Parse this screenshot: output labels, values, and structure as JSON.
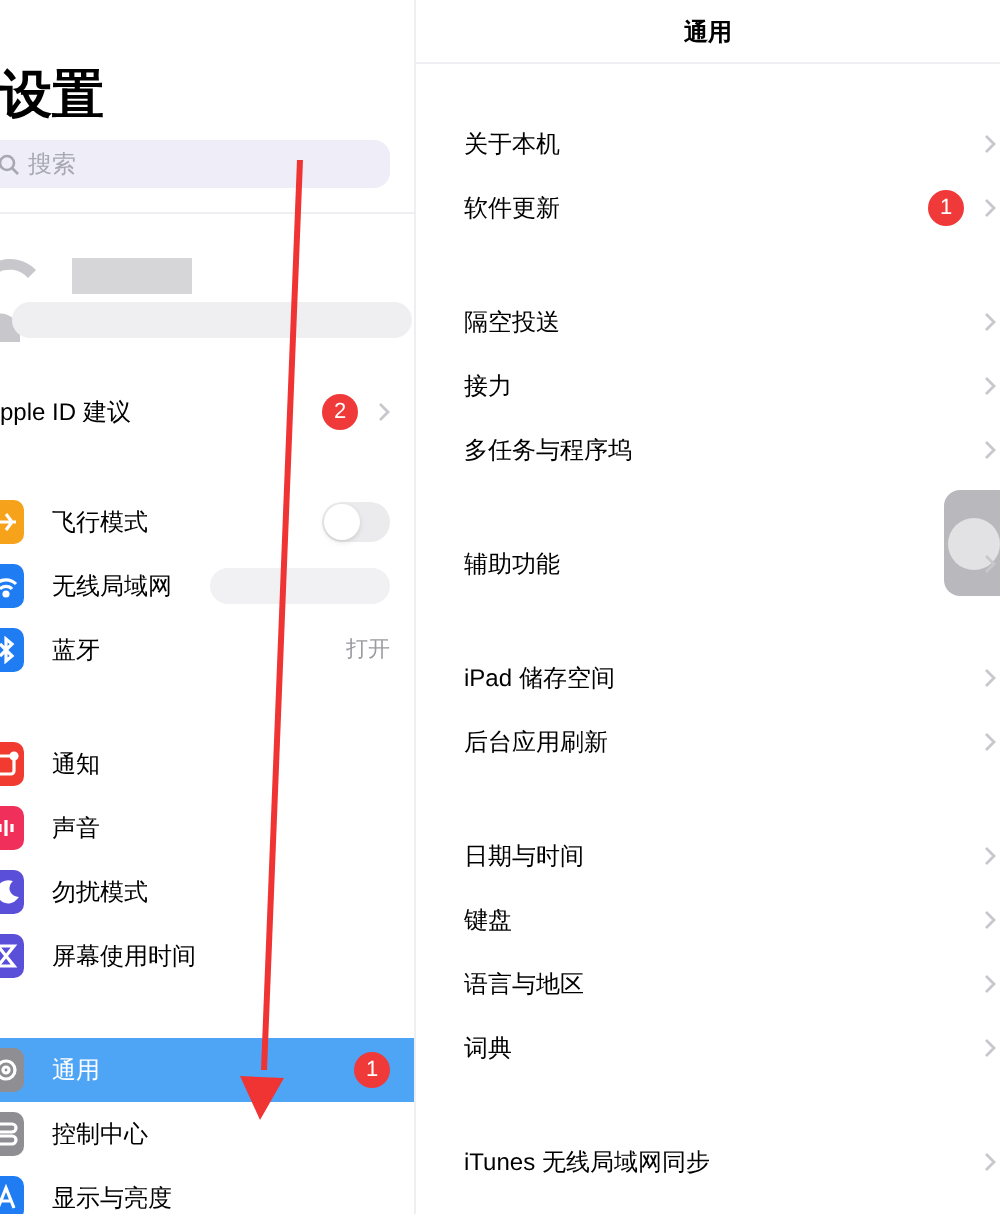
{
  "sidebar": {
    "title": "设置",
    "search": {
      "placeholder": "搜索"
    },
    "apple_id": {
      "label": "pple ID 建议",
      "badge": "2"
    },
    "groups": [
      [
        {
          "kind": "toggle",
          "label": "飞行模式",
          "color": "#f7a21b",
          "on": false,
          "selected": false
        },
        {
          "kind": "value",
          "label": "无线局域网",
          "color": "#1f7cf2",
          "selected": false
        },
        {
          "kind": "value",
          "label": "蓝牙",
          "color": "#1f7cf2",
          "value": "打开",
          "selected": false
        }
      ],
      [
        {
          "kind": "link",
          "label": "通知",
          "color": "#f23b30",
          "selected": false
        },
        {
          "kind": "link",
          "label": "声音",
          "color": "#f0305a",
          "selected": false
        },
        {
          "kind": "link",
          "label": "勿扰模式",
          "color": "#5a4fd8",
          "selected": false
        },
        {
          "kind": "link",
          "label": "屏幕使用时间",
          "color": "#5a4fd8",
          "selected": false
        }
      ],
      [
        {
          "kind": "link",
          "label": "通用",
          "color": "#8e8e93",
          "badge": "1",
          "selected": true
        },
        {
          "kind": "link",
          "label": "控制中心",
          "color": "#8e8e93",
          "selected": false
        },
        {
          "kind": "link",
          "label": "显示与亮度",
          "color": "#1f7cf2",
          "selected": false
        }
      ]
    ]
  },
  "detail": {
    "title": "通用",
    "groups": [
      [
        {
          "label": "关于本机"
        },
        {
          "label": "软件更新",
          "badge": "1"
        }
      ],
      [
        {
          "label": "隔空投送"
        },
        {
          "label": "接力"
        },
        {
          "label": "多任务与程序坞"
        }
      ],
      [
        {
          "label": "辅助功能"
        }
      ],
      [
        {
          "label": "iPad 储存空间"
        },
        {
          "label": "后台应用刷新"
        }
      ],
      [
        {
          "label": "日期与时间"
        },
        {
          "label": "键盘"
        },
        {
          "label": "语言与地区"
        },
        {
          "label": "词典"
        }
      ],
      [
        {
          "label": "iTunes 无线局域网同步"
        }
      ]
    ]
  }
}
